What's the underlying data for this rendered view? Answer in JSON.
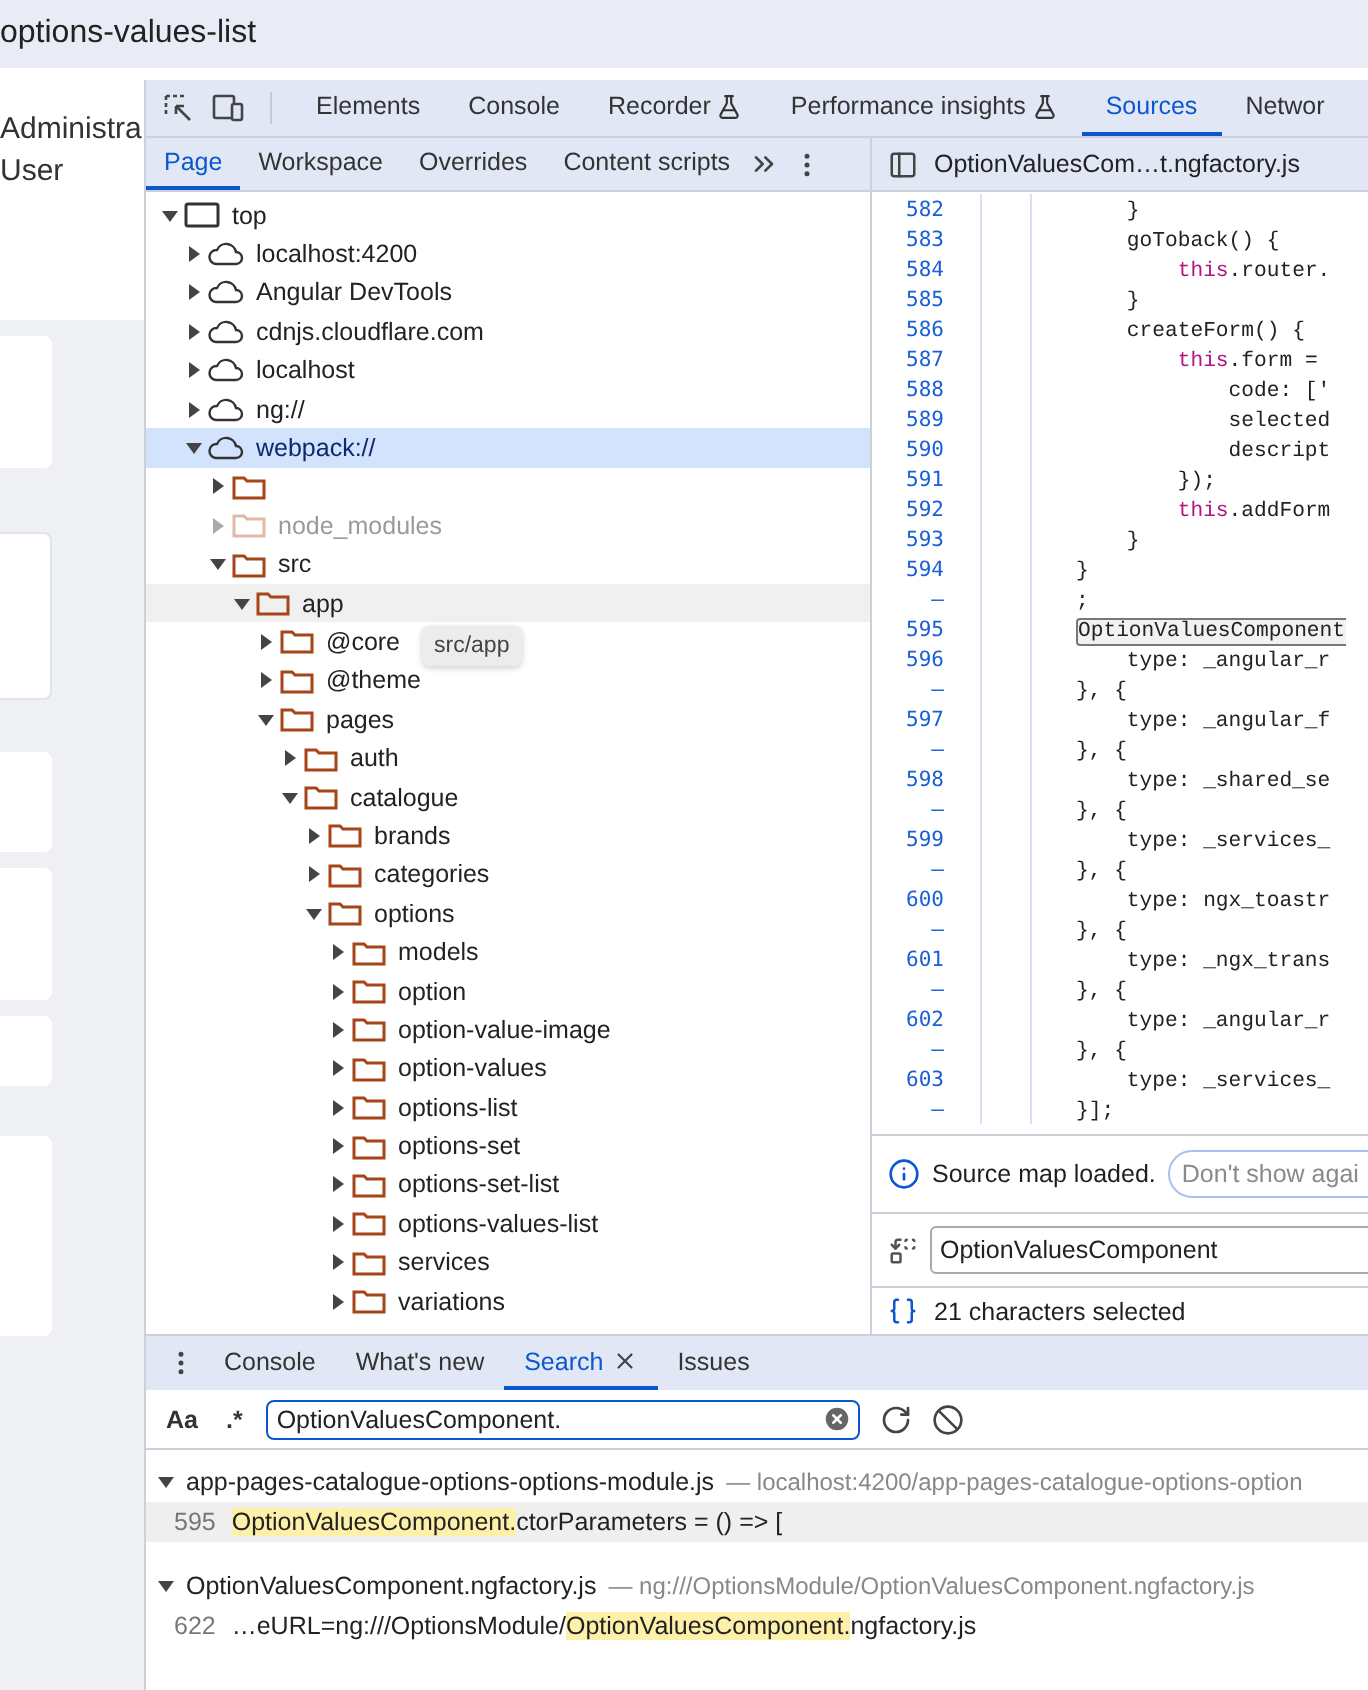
{
  "browser_tab": {
    "title": "options-values-list"
  },
  "page": {
    "user_lines": [
      "Administra",
      "User"
    ]
  },
  "devtools": {
    "main_tabs": [
      {
        "label": "Elements",
        "selected": false,
        "experimental": false
      },
      {
        "label": "Console",
        "selected": false,
        "experimental": false
      },
      {
        "label": "Recorder",
        "selected": false,
        "experimental": true
      },
      {
        "label": "Performance insights",
        "selected": false,
        "experimental": true
      },
      {
        "label": "Sources",
        "selected": true,
        "experimental": false
      },
      {
        "label": "Networ",
        "selected": false,
        "experimental": false
      }
    ],
    "navigator_tabs": [
      {
        "label": "Page",
        "selected": true
      },
      {
        "label": "Workspace",
        "selected": false
      },
      {
        "label": "Overrides",
        "selected": false
      },
      {
        "label": "Content scripts",
        "selected": false
      }
    ],
    "tree": [
      {
        "kind": "frame",
        "name": "top",
        "expanded": true,
        "selected": false,
        "dimmed": false,
        "hovered": false,
        "children": [
          {
            "kind": "cloud",
            "name": "localhost:4200",
            "expanded": false,
            "selected": false,
            "dimmed": false,
            "hovered": false
          },
          {
            "kind": "cloud",
            "name": "Angular DevTools",
            "expanded": false,
            "selected": false,
            "dimmed": false,
            "hovered": false
          },
          {
            "kind": "cloud",
            "name": "cdnjs.cloudflare.com",
            "expanded": false,
            "selected": false,
            "dimmed": false,
            "hovered": false
          },
          {
            "kind": "cloud",
            "name": "localhost",
            "expanded": false,
            "selected": false,
            "dimmed": false,
            "hovered": false
          },
          {
            "kind": "cloud",
            "name": "ng://",
            "expanded": false,
            "selected": false,
            "dimmed": false,
            "hovered": false
          },
          {
            "kind": "cloud",
            "name": "webpack://",
            "expanded": true,
            "selected": true,
            "dimmed": false,
            "hovered": false,
            "children": [
              {
                "kind": "folder",
                "expanded": false,
                "selected": false,
                "dimmed": false,
                "hovered": false
              },
              {
                "kind": "folder",
                "name": "node_modules",
                "expanded": false,
                "selected": false,
                "dimmed": true,
                "hovered": false
              },
              {
                "kind": "folder",
                "name": "src",
                "expanded": true,
                "selected": false,
                "dimmed": false,
                "hovered": false,
                "children": [
                  {
                    "kind": "folder",
                    "name": "app",
                    "expanded": true,
                    "selected": false,
                    "dimmed": false,
                    "hovered": true,
                    "tooltip": "src/app",
                    "children": [
                      {
                        "kind": "folder",
                        "name": "@core",
                        "expanded": false,
                        "selected": false,
                        "dimmed": false,
                        "hovered": false
                      },
                      {
                        "kind": "folder",
                        "name": "@theme",
                        "expanded": false,
                        "selected": false,
                        "dimmed": false,
                        "hovered": false
                      },
                      {
                        "kind": "folder",
                        "name": "pages",
                        "expanded": true,
                        "selected": false,
                        "dimmed": false,
                        "hovered": false,
                        "children": [
                          {
                            "kind": "folder",
                            "name": "auth",
                            "expanded": false,
                            "selected": false,
                            "dimmed": false,
                            "hovered": false
                          },
                          {
                            "kind": "folder",
                            "name": "catalogue",
                            "expanded": true,
                            "selected": false,
                            "dimmed": false,
                            "hovered": false,
                            "children": [
                              {
                                "kind": "folder",
                                "name": "brands",
                                "expanded": false,
                                "selected": false,
                                "dimmed": false,
                                "hovered": false
                              },
                              {
                                "kind": "folder",
                                "name": "categories",
                                "expanded": false,
                                "selected": false,
                                "dimmed": false,
                                "hovered": false
                              },
                              {
                                "kind": "folder",
                                "name": "options",
                                "expanded": true,
                                "selected": false,
                                "dimmed": false,
                                "hovered": false,
                                "children": [
                                  {
                                    "kind": "folder",
                                    "name": "models",
                                    "expanded": false,
                                    "selected": false,
                                    "dimmed": false,
                                    "hovered": false
                                  },
                                  {
                                    "kind": "folder",
                                    "name": "option",
                                    "expanded": false,
                                    "selected": false,
                                    "dimmed": false,
                                    "hovered": false
                                  },
                                  {
                                    "kind": "folder",
                                    "name": "option-value-image",
                                    "expanded": false,
                                    "selected": false,
                                    "dimmed": false,
                                    "hovered": false
                                  },
                                  {
                                    "kind": "folder",
                                    "name": "option-values",
                                    "expanded": false,
                                    "selected": false,
                                    "dimmed": false,
                                    "hovered": false
                                  },
                                  {
                                    "kind": "folder",
                                    "name": "options-list",
                                    "expanded": false,
                                    "selected": false,
                                    "dimmed": false,
                                    "hovered": false
                                  },
                                  {
                                    "kind": "folder",
                                    "name": "options-set",
                                    "expanded": false,
                                    "selected": false,
                                    "dimmed": false,
                                    "hovered": false
                                  },
                                  {
                                    "kind": "folder",
                                    "name": "options-set-list",
                                    "expanded": false,
                                    "selected": false,
                                    "dimmed": false,
                                    "hovered": false
                                  },
                                  {
                                    "kind": "folder",
                                    "name": "options-values-list",
                                    "expanded": false,
                                    "selected": false,
                                    "dimmed": false,
                                    "hovered": false
                                  },
                                  {
                                    "kind": "folder",
                                    "name": "services",
                                    "expanded": false,
                                    "selected": false,
                                    "dimmed": false,
                                    "hovered": false
                                  },
                                  {
                                    "kind": "folder",
                                    "name": "variations",
                                    "expanded": false,
                                    "selected": false,
                                    "dimmed": false,
                                    "hovered": false
                                  }
                                ]
                              }
                            ]
                          }
                        ]
                      }
                    ]
                  }
                ]
              }
            ]
          }
        ]
      }
    ],
    "editor": {
      "file_tab": "OptionValuesCom…t.ngfactory.js",
      "lines": [
        {
          "number": "582",
          "parts": [
            {
              "kind": "plain",
              "text": "    }"
            }
          ]
        },
        {
          "number": "583",
          "parts": [
            {
              "kind": "plain",
              "text": "    goToback() {"
            }
          ]
        },
        {
          "number": "584",
          "parts": [
            {
              "kind": "keyword",
              "text": "        this"
            },
            {
              "kind": "plain",
              "text": ".router."
            }
          ]
        },
        {
          "number": "585",
          "parts": [
            {
              "kind": "plain",
              "text": "    }"
            }
          ]
        },
        {
          "number": "586",
          "parts": [
            {
              "kind": "plain",
              "text": "    createForm() {"
            }
          ]
        },
        {
          "number": "587",
          "parts": [
            {
              "kind": "keyword",
              "text": "        this"
            },
            {
              "kind": "plain",
              "text": ".form ="
            }
          ]
        },
        {
          "number": "588",
          "parts": [
            {
              "kind": "plain",
              "text": "            code: ['"
            }
          ]
        },
        {
          "number": "589",
          "parts": [
            {
              "kind": "plain",
              "text": "            selected"
            }
          ]
        },
        {
          "number": "590",
          "parts": [
            {
              "kind": "plain",
              "text": "            descript"
            }
          ]
        },
        {
          "number": "591",
          "parts": [
            {
              "kind": "plain",
              "text": "        });"
            }
          ]
        },
        {
          "number": "592",
          "parts": [
            {
              "kind": "keyword",
              "text": "        this"
            },
            {
              "kind": "plain",
              "text": ".addForm"
            }
          ]
        },
        {
          "number": "593",
          "parts": [
            {
              "kind": "plain",
              "text": "    }"
            }
          ]
        },
        {
          "number": "594",
          "parts": [
            {
              "kind": "plain",
              "text": "}"
            }
          ]
        },
        {
          "number": "–",
          "parts": [
            {
              "kind": "plain",
              "text": ";"
            }
          ]
        },
        {
          "number": "595",
          "parts": [
            {
              "kind": "match",
              "text": "OptionValuesComponent"
            }
          ]
        },
        {
          "number": "596",
          "parts": [
            {
              "kind": "plain",
              "text": "    type: _angular_r"
            }
          ]
        },
        {
          "number": "–",
          "parts": [
            {
              "kind": "plain",
              "text": "}, {"
            }
          ]
        },
        {
          "number": "597",
          "parts": [
            {
              "kind": "plain",
              "text": "    type: _angular_f"
            }
          ]
        },
        {
          "number": "–",
          "parts": [
            {
              "kind": "plain",
              "text": "}, {"
            }
          ]
        },
        {
          "number": "598",
          "parts": [
            {
              "kind": "plain",
              "text": "    type: _shared_se"
            }
          ]
        },
        {
          "number": "–",
          "parts": [
            {
              "kind": "plain",
              "text": "}, {"
            }
          ]
        },
        {
          "number": "599",
          "parts": [
            {
              "kind": "plain",
              "text": "    type: _services_"
            }
          ]
        },
        {
          "number": "–",
          "parts": [
            {
              "kind": "plain",
              "text": "}, {"
            }
          ]
        },
        {
          "number": "600",
          "parts": [
            {
              "kind": "plain",
              "text": "    type: ngx_toastr"
            }
          ]
        },
        {
          "number": "–",
          "parts": [
            {
              "kind": "plain",
              "text": "}, {"
            }
          ]
        },
        {
          "number": "601",
          "parts": [
            {
              "kind": "plain",
              "text": "    type: _ngx_trans"
            }
          ]
        },
        {
          "number": "–",
          "parts": [
            {
              "kind": "plain",
              "text": "}, {"
            }
          ]
        },
        {
          "number": "602",
          "parts": [
            {
              "kind": "plain",
              "text": "    type: _angular_r"
            }
          ]
        },
        {
          "number": "–",
          "parts": [
            {
              "kind": "plain",
              "text": "}, {"
            }
          ]
        },
        {
          "number": "603",
          "parts": [
            {
              "kind": "plain",
              "text": "    type: _services_"
            }
          ]
        },
        {
          "number": "–",
          "parts": [
            {
              "kind": "plain",
              "text": "}];"
            }
          ]
        }
      ],
      "infobar": {
        "message": "Source map loaded.",
        "button": "Don't show agai"
      },
      "find": {
        "value": "OptionValuesComponent"
      },
      "status": "21 characters selected"
    },
    "drawer": {
      "tabs": [
        {
          "label": "Console",
          "selected": false,
          "closable": false
        },
        {
          "label": "What's new",
          "selected": false,
          "closable": false
        },
        {
          "label": "Search",
          "selected": true,
          "closable": true
        },
        {
          "label": "Issues",
          "selected": false,
          "closable": false
        }
      ],
      "match_case": "Aa",
      "regex": ".*",
      "search": {
        "value": "OptionValuesComponent."
      },
      "results": [
        {
          "file": "app-pages-catalogue-options-options-module.js",
          "path": "— localhost:4200/app-pages-catalogue-options-option",
          "expanded": true,
          "matches": [
            {
              "line": "595",
              "match": "OptionValuesComponent.",
              "after": "ctorParameters = () => [",
              "selected": true
            }
          ]
        },
        {
          "file": "OptionValuesComponent.ngfactory.js",
          "path": "— ng:///OptionsModule/OptionValuesComponent.ngfactory.js",
          "expanded": true,
          "matches": [
            {
              "line": "622",
              "before": "…eURL=ng:///OptionsModule/",
              "match": "OptionValuesComponent.",
              "after": "ngfactory.js",
              "selected": false
            }
          ]
        }
      ]
    }
  }
}
